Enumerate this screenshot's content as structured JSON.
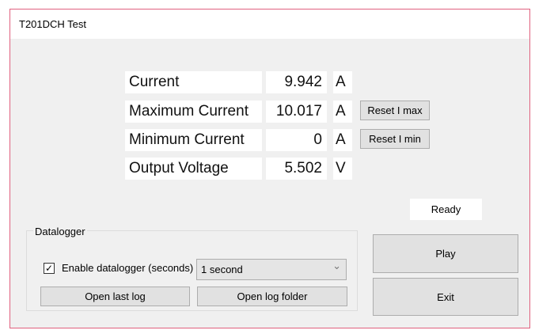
{
  "window": {
    "title": "T201DCH Test",
    "accent": "#e0607e"
  },
  "readings": [
    {
      "label": "Current",
      "value": "9.942",
      "unit": "A"
    },
    {
      "label": "Maximum Current",
      "value": "10.017",
      "unit": "A",
      "button": "Reset I max"
    },
    {
      "label": "Minimum Current",
      "value": "0",
      "unit": "A",
      "button": "Reset I min"
    },
    {
      "label": "Output Voltage",
      "value": "5.502",
      "unit": "V"
    }
  ],
  "status": "Ready",
  "datalogger": {
    "title": "Datalogger",
    "enable_label": "Enable datalogger (seconds)",
    "checked": true,
    "check_glyph": "✓",
    "interval": "1 second",
    "chevron": "⌄",
    "open_last_log": "Open last log",
    "open_log_folder": "Open log folder"
  },
  "actions": {
    "play": "Play",
    "exit": "Exit"
  }
}
